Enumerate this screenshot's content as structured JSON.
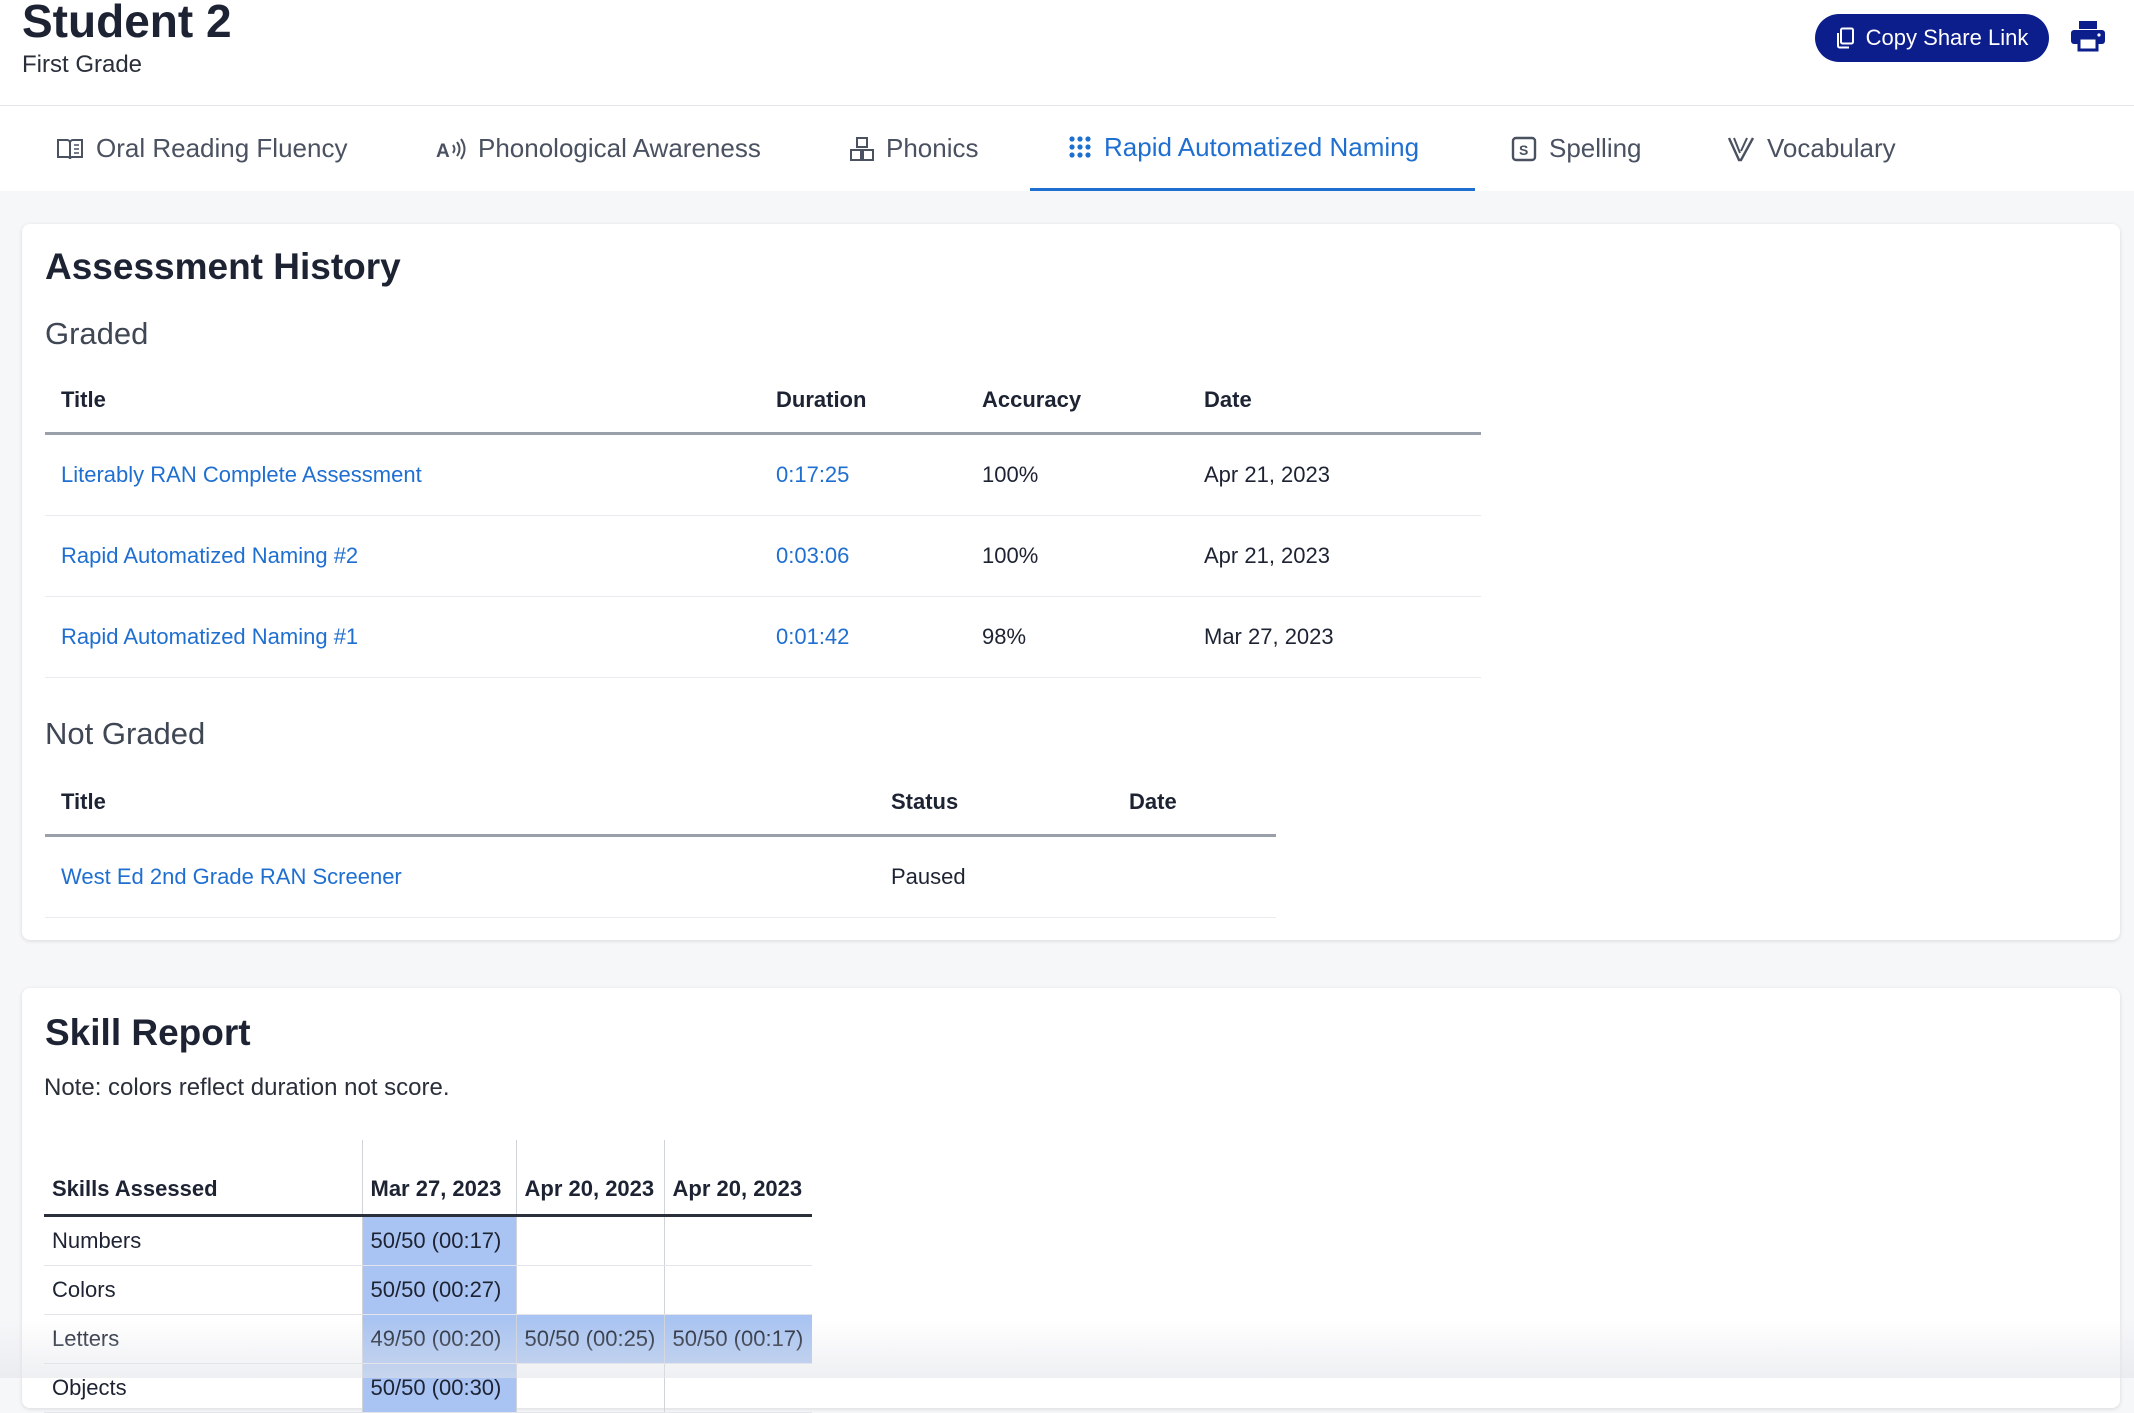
{
  "header": {
    "student_name": "Student 2",
    "grade": "First Grade",
    "share_button_label": "Copy Share Link",
    "print_icon": "print-icon",
    "brand_color": "#0c1d8c"
  },
  "tabs": [
    {
      "label": "Oral Reading Fluency",
      "icon": "book-icon"
    },
    {
      "label": "Phonological Awareness",
      "icon": "sound-icon"
    },
    {
      "label": "Phonics",
      "icon": "blocks-icon"
    },
    {
      "label": "Rapid Automatized Naming",
      "icon": "grid-icon",
      "active": true
    },
    {
      "label": "Spelling",
      "icon": "spelling-icon"
    },
    {
      "label": "Vocabulary",
      "icon": "vocabulary-icon"
    }
  ],
  "accent_color": "#1f6fd1",
  "assessment_history": {
    "title": "Assessment History",
    "graded": {
      "title": "Graded",
      "columns": [
        "Title",
        "Duration",
        "Accuracy",
        "Date"
      ],
      "rows": [
        {
          "title": "Literably RAN Complete Assessment",
          "duration": "0:17:25",
          "accuracy": "100%",
          "date": "Apr 21, 2023"
        },
        {
          "title": "Rapid Automatized Naming #2",
          "duration": "0:03:06",
          "accuracy": "100%",
          "date": "Apr 21, 2023"
        },
        {
          "title": "Rapid Automatized Naming #1",
          "duration": "0:01:42",
          "accuracy": "98%",
          "date": "Mar 27, 2023"
        }
      ]
    },
    "not_graded": {
      "title": "Not Graded",
      "columns": [
        "Title",
        "Status",
        "Date"
      ],
      "rows": [
        {
          "title": "West Ed 2nd Grade RAN Screener",
          "status": "Paused",
          "date": ""
        }
      ]
    }
  },
  "skill_report": {
    "title": "Skill Report",
    "note": "Note: colors reflect duration not score.",
    "columns": [
      "Skills Assessed",
      "Mar 27, 2023",
      "Apr 20, 2023",
      "Apr 20, 2023"
    ],
    "cell_color": "#a9c4f2",
    "rows": [
      {
        "skill": "Numbers",
        "cells": [
          "50/50 (00:17)",
          "",
          ""
        ]
      },
      {
        "skill": "Colors",
        "cells": [
          "50/50 (00:27)",
          "",
          ""
        ]
      },
      {
        "skill": "Letters",
        "cells": [
          "49/50 (00:20)",
          "50/50 (00:25)",
          "50/50 (00:17)"
        ]
      },
      {
        "skill": "Objects",
        "cells": [
          "50/50 (00:30)",
          "",
          ""
        ]
      }
    ]
  }
}
